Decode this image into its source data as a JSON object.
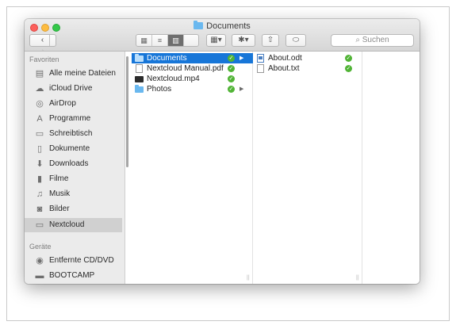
{
  "window": {
    "title": "Documents"
  },
  "toolbar": {
    "back_label": "‹",
    "forward_label": "›",
    "views": [
      {
        "name": "icon-view",
        "glyph": "▦",
        "active": false
      },
      {
        "name": "list-view",
        "glyph": "≡",
        "active": false
      },
      {
        "name": "column-view",
        "glyph": "▥",
        "active": true
      },
      {
        "name": "coverflow-view",
        "glyph": "▭",
        "active": false
      }
    ],
    "arrange_glyph": "▦▾",
    "action_glyph": "✱▾",
    "share_glyph": "⇧",
    "tag_glyph": "⬭",
    "search_placeholder": "Suchen"
  },
  "sidebar": {
    "favorites_heading": "Favoriten",
    "devices_heading": "Geräte",
    "favorites": [
      {
        "label": "Alle meine Dateien",
        "icon": "all-files-icon",
        "glyph": "▤",
        "selected": false
      },
      {
        "label": "iCloud Drive",
        "icon": "cloud-icon",
        "glyph": "☁",
        "selected": false
      },
      {
        "label": "AirDrop",
        "icon": "airdrop-icon",
        "glyph": "◎",
        "selected": false
      },
      {
        "label": "Programme",
        "icon": "applications-icon",
        "glyph": "A",
        "selected": false
      },
      {
        "label": "Schreibtisch",
        "icon": "desktop-icon",
        "glyph": "▭",
        "selected": false
      },
      {
        "label": "Dokumente",
        "icon": "documents-icon",
        "glyph": "▯",
        "selected": false
      },
      {
        "label": "Downloads",
        "icon": "downloads-icon",
        "glyph": "⬇",
        "selected": false
      },
      {
        "label": "Filme",
        "icon": "movies-icon",
        "glyph": "▮",
        "selected": false
      },
      {
        "label": "Musik",
        "icon": "music-icon",
        "glyph": "♫",
        "selected": false
      },
      {
        "label": "Bilder",
        "icon": "pictures-icon",
        "glyph": "◙",
        "selected": false
      },
      {
        "label": "Nextcloud",
        "icon": "folder-icon",
        "glyph": "▭",
        "selected": true
      }
    ],
    "devices": [
      {
        "label": "Entfernte CD/DVD",
        "icon": "disc-icon",
        "glyph": "◉",
        "selected": false
      },
      {
        "label": "BOOTCAMP",
        "icon": "drive-icon",
        "glyph": "▬",
        "selected": false
      }
    ]
  },
  "columns": {
    "first": [
      {
        "label": "Documents",
        "kind": "folder",
        "selected": true,
        "synced": true,
        "has_children": true
      },
      {
        "label": "Nextcloud Manual.pdf",
        "kind": "pdf",
        "selected": false,
        "synced": true,
        "has_children": false
      },
      {
        "label": "Nextcloud.mp4",
        "kind": "video",
        "selected": false,
        "synced": true,
        "has_children": false
      },
      {
        "label": "Photos",
        "kind": "folder",
        "selected": false,
        "synced": true,
        "has_children": true
      }
    ],
    "second": [
      {
        "label": "About.odt",
        "kind": "odt",
        "selected": false,
        "synced": true
      },
      {
        "label": "About.txt",
        "kind": "txt",
        "selected": false,
        "synced": true
      }
    ]
  },
  "colors": {
    "selection": "#1776d8",
    "sync_ok": "#51b436",
    "folder": "#6ab8ef"
  }
}
